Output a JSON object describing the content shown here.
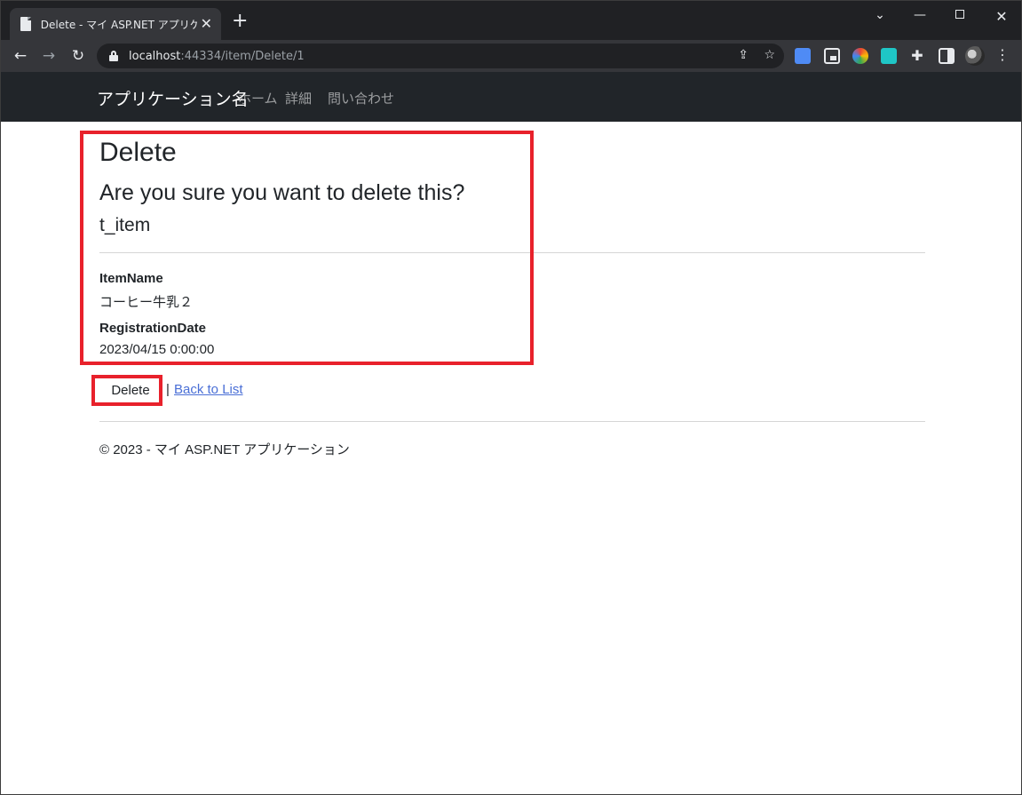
{
  "browser": {
    "tab_title": "Delete - マイ ASP.NET アプリケーショ",
    "tab_close_glyph": "✕",
    "new_tab_glyph": "+",
    "url_host": "localhost",
    "url_rest": ":44334/item/Delete/1",
    "icons": {
      "back": "arrow-left-icon",
      "forward": "arrow-right-icon",
      "reload": "reload-icon",
      "share": "share-icon",
      "star": "bookmark-star-icon",
      "extensions": "puzzle-icon",
      "menu": "kebab-menu-icon"
    },
    "colors": {
      "tabstrip": "#202124",
      "toolbar": "#35363a",
      "omnibox": "#202124"
    }
  },
  "app": {
    "brand": "アプリケーション名",
    "nav": [
      "ホーム",
      "詳細",
      "問い合わせ"
    ],
    "navbar_color": "#212529"
  },
  "page": {
    "title": "Delete",
    "confirm": "Are you sure you want to delete this?",
    "entity": "t_item",
    "fields": [
      {
        "label": "ItemName",
        "value": "コーヒー牛乳２"
      },
      {
        "label": "RegistrationDate",
        "value": "2023/04/15 0:00:00"
      }
    ],
    "delete_button": "Delete",
    "separator": "|",
    "back_link": "Back to List",
    "footer": "© 2023 - マイ ASP.NET アプリケーション"
  },
  "annotation_color": "#e8212b"
}
